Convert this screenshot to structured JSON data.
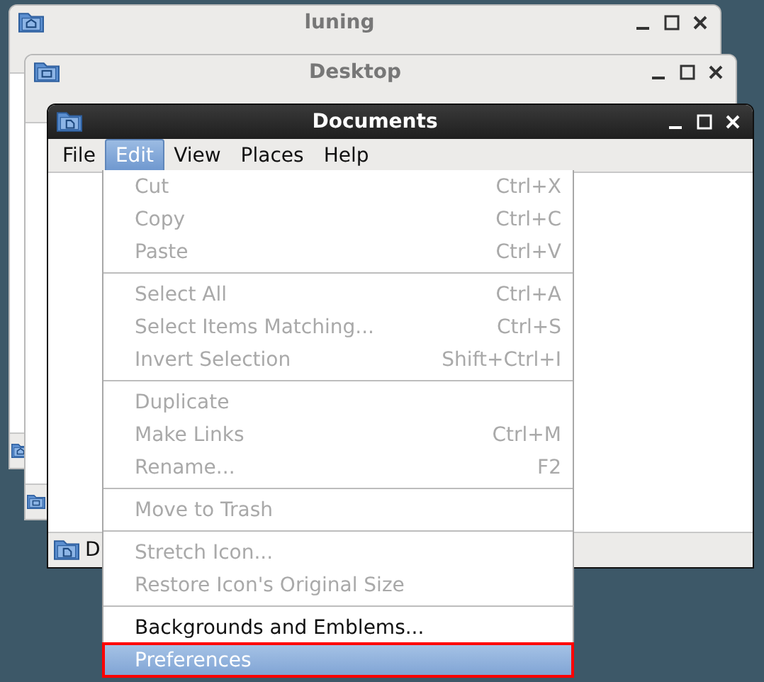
{
  "background_windows": [
    {
      "title": "luning",
      "kind": "home"
    },
    {
      "title": "Desktop",
      "kind": "desktop"
    }
  ],
  "main_window": {
    "title": "Documents",
    "status_text": "D",
    "menu_bar": [
      {
        "label": "File",
        "selected": false
      },
      {
        "label": "Edit",
        "selected": true
      },
      {
        "label": "View",
        "selected": false
      },
      {
        "label": "Places",
        "selected": false
      },
      {
        "label": "Help",
        "selected": false
      }
    ]
  },
  "edit_menu": {
    "groups": [
      [
        {
          "label": "Cut",
          "shortcut": "Ctrl+X",
          "disabled": true,
          "selected": false,
          "outlined": false
        },
        {
          "label": "Copy",
          "shortcut": "Ctrl+C",
          "disabled": true,
          "selected": false,
          "outlined": false
        },
        {
          "label": "Paste",
          "shortcut": "Ctrl+V",
          "disabled": true,
          "selected": false,
          "outlined": false
        }
      ],
      [
        {
          "label": "Select All",
          "shortcut": "Ctrl+A",
          "disabled": true,
          "selected": false,
          "outlined": false
        },
        {
          "label": "Select Items Matching...",
          "shortcut": "Ctrl+S",
          "disabled": true,
          "selected": false,
          "outlined": false
        },
        {
          "label": "Invert Selection",
          "shortcut": "Shift+Ctrl+I",
          "disabled": true,
          "selected": false,
          "outlined": false
        }
      ],
      [
        {
          "label": "Duplicate",
          "disabled": true,
          "selected": false,
          "outlined": false
        },
        {
          "label": "Make Links",
          "shortcut": "Ctrl+M",
          "disabled": true,
          "selected": false,
          "outlined": false
        },
        {
          "label": "Rename...",
          "shortcut": "F2",
          "disabled": true,
          "selected": false,
          "outlined": false
        }
      ],
      [
        {
          "label": "Move to Trash",
          "disabled": true,
          "selected": false,
          "outlined": false
        }
      ],
      [
        {
          "label": "Stretch Icon...",
          "disabled": true,
          "selected": false,
          "outlined": false
        },
        {
          "label": "Restore Icon's Original Size",
          "disabled": true,
          "selected": false,
          "outlined": false
        }
      ],
      [
        {
          "label": "Backgrounds and Emblems...",
          "disabled": false,
          "selected": false,
          "outlined": false
        },
        {
          "label": "Preferences",
          "disabled": false,
          "selected": true,
          "outlined": true
        }
      ]
    ]
  }
}
